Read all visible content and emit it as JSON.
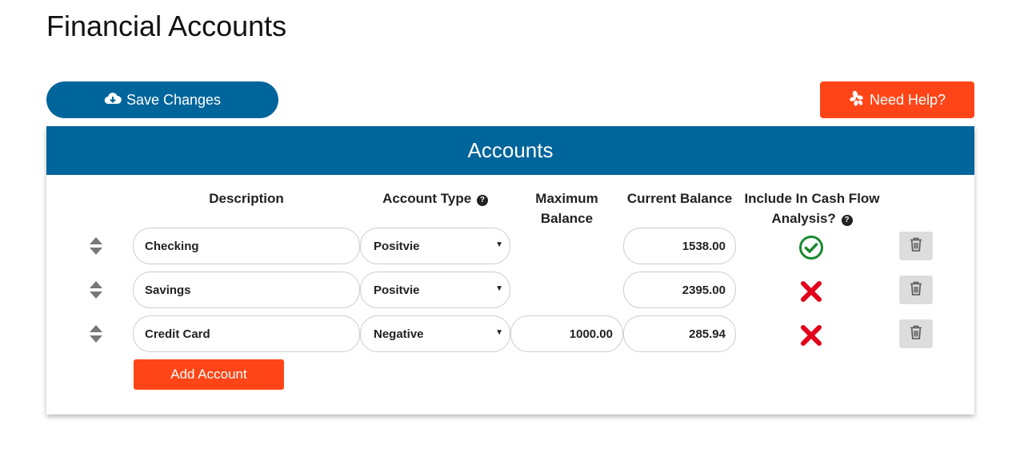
{
  "page_title": "Financial Accounts",
  "toolbar": {
    "save_label": "Save Changes",
    "help_label": "Need Help?"
  },
  "panel": {
    "title": "Accounts",
    "columns": {
      "description": "Description",
      "account_type": "Account Type",
      "maximum_balance_line1": "Maximum",
      "maximum_balance_line2": "Balance",
      "current_balance": "Current Balance",
      "include_line1": "Include In Cash Flow",
      "include_line2": "Analysis?"
    },
    "accounts": [
      {
        "description": "Checking",
        "type": "Positvie",
        "max_balance": "",
        "current_balance": "1538.00",
        "include": true
      },
      {
        "description": "Savings",
        "type": "Positvie",
        "max_balance": "",
        "current_balance": "2395.00",
        "include": false
      },
      {
        "description": "Credit Card",
        "type": "Negative",
        "max_balance": "1000.00",
        "current_balance": "285.94",
        "include": false
      }
    ],
    "add_label": "Add Account"
  },
  "colors": {
    "primary": "#00659a",
    "accent": "#ff4517",
    "success": "#1a8a2e",
    "danger": "#e3001b"
  },
  "icons": {
    "save": "cloud-download-icon",
    "help": "help-icon",
    "drag": "drag-handle-icon",
    "include_yes": "check-circle-icon",
    "include_no": "x-icon",
    "delete": "trash-icon",
    "info": "question-circle-icon"
  }
}
